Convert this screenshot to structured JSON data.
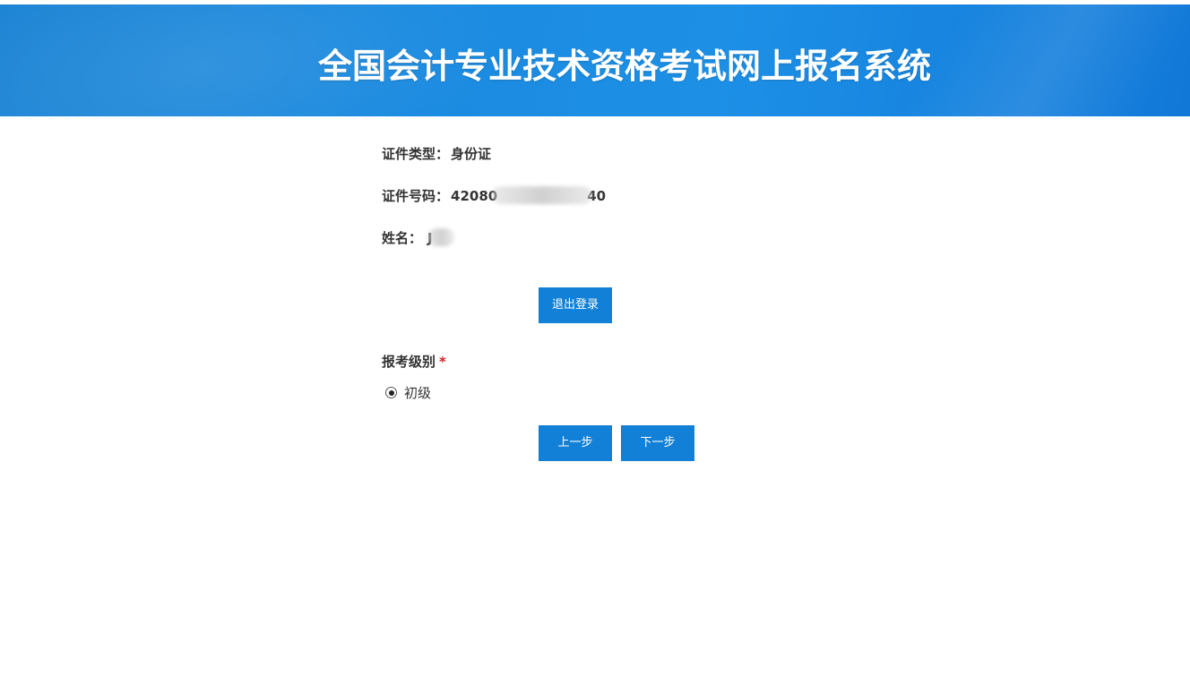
{
  "header": {
    "title": "全国会计专业技术资格考试网上报名系统"
  },
  "info": {
    "id_type_label": "证件类型：",
    "id_type_value": "身份证",
    "id_number_label": "证件号码：",
    "id_number_prefix": "42080",
    "id_number_suffix": "40",
    "name_label": "姓名：",
    "name_value": "J"
  },
  "actions": {
    "logout_label": "退出登录",
    "prev_label": "上一步",
    "next_label": "下一步"
  },
  "exam_level": {
    "label": "报考级别",
    "required_mark": "*",
    "options": [
      {
        "label": "初级",
        "selected": true
      }
    ]
  },
  "colors": {
    "header_bg": "#1a8ae0",
    "button_bg": "#1180d6",
    "required": "#d21f1f"
  }
}
